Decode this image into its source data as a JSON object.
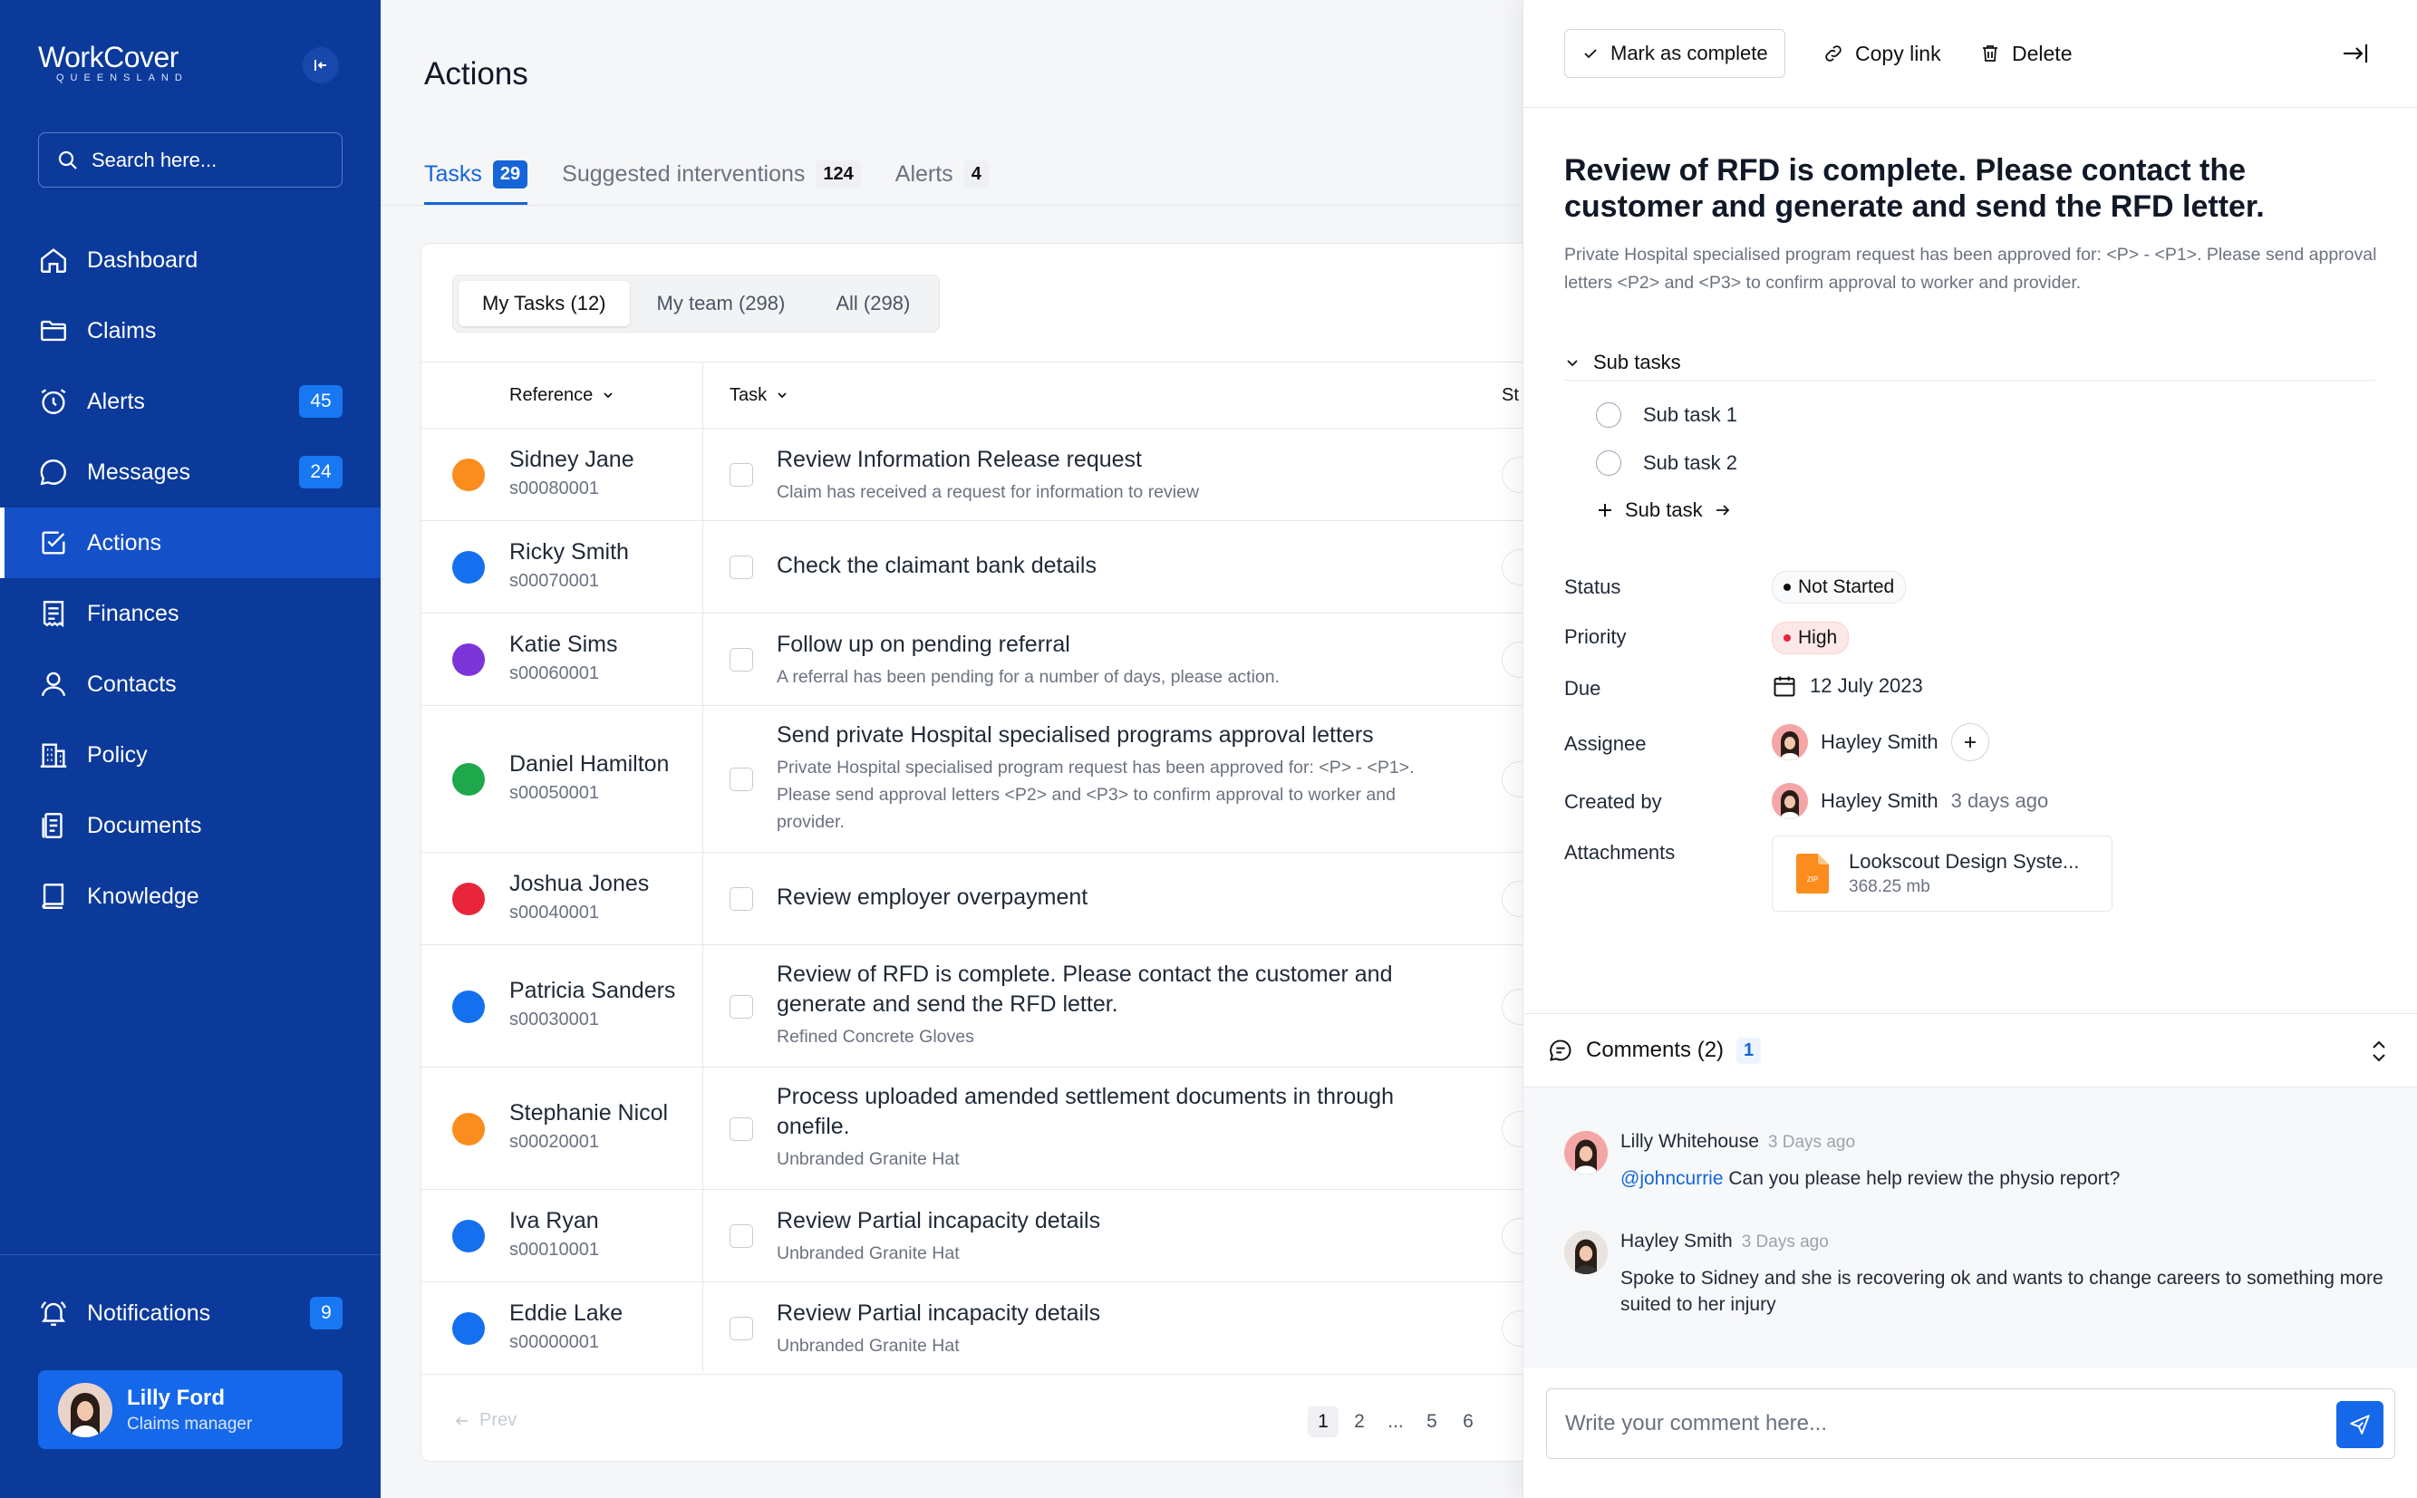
{
  "brand": {
    "logo_main": "WorkCover",
    "logo_sub": "QUEENSLAND"
  },
  "sidebar": {
    "search_placeholder": "Search here...",
    "items": [
      {
        "label": "Dashboard",
        "icon": "home-icon"
      },
      {
        "label": "Claims",
        "icon": "folder-icon"
      },
      {
        "label": "Alerts",
        "icon": "alarm-icon",
        "badge": "45"
      },
      {
        "label": "Messages",
        "icon": "chat-icon",
        "badge": "24"
      },
      {
        "label": "Actions",
        "icon": "checkbox-icon",
        "active": true
      },
      {
        "label": "Finances",
        "icon": "receipt-icon"
      },
      {
        "label": "Contacts",
        "icon": "user-icon"
      },
      {
        "label": "Policy",
        "icon": "building-icon"
      },
      {
        "label": "Documents",
        "icon": "document-icon"
      },
      {
        "label": "Knowledge",
        "icon": "book-icon"
      }
    ],
    "notifications": {
      "label": "Notifications",
      "badge": "9"
    },
    "user": {
      "name": "Lilly Ford",
      "role": "Claims manager"
    }
  },
  "main": {
    "title": "Actions",
    "tabs": [
      {
        "label": "Tasks",
        "count": "29",
        "active": true
      },
      {
        "label": "Suggested interventions",
        "count": "124"
      },
      {
        "label": "Alerts",
        "count": "4"
      }
    ],
    "segments": [
      "My Tasks (12)",
      "My team (298)",
      "All (298)"
    ],
    "columns": {
      "reference": "Reference",
      "task": "Task",
      "status": "St"
    },
    "rows": [
      {
        "name": "Sidney Jane",
        "id": "s00080001",
        "color": "#fb8c1e",
        "title": "Review Information Release request",
        "sub": "Claim has received a request for information to review"
      },
      {
        "name": "Ricky Smith",
        "id": "s00070001",
        "color": "#1570ef",
        "title": "Check the claimant bank details",
        "sub": ""
      },
      {
        "name": "Katie Sims",
        "id": "s00060001",
        "color": "#7c35d8",
        "title": "Follow up on pending referral",
        "sub": "A referral has been pending for a number of days, please action."
      },
      {
        "name": "Daniel Hamilton",
        "id": "s00050001",
        "color": "#1ea84b",
        "title": "Send private Hospital specialised programs approval letters",
        "sub": "Private Hospital specialised program request has been approved for: <P> - <P1>. Please send approval letters <P2> and <P3> to confirm approval to worker and provider."
      },
      {
        "name": "Joshua Jones",
        "id": "s00040001",
        "color": "#e8253b",
        "title": "Review employer overpayment",
        "sub": ""
      },
      {
        "name": "Patricia Sanders",
        "id": "s00030001",
        "color": "#1570ef",
        "title": "Review of RFD is complete. Please contact the customer and generate and send the RFD letter.",
        "sub": "Refined Concrete Gloves"
      },
      {
        "name": "Stephanie Nicol",
        "id": "s00020001",
        "color": "#fb8c1e",
        "title": "Process uploaded amended settlement documents in through onefile.",
        "sub": "Unbranded Granite Hat"
      },
      {
        "name": "Iva Ryan",
        "id": "s00010001",
        "color": "#1570ef",
        "title": "Review Partial incapacity details",
        "sub": "Unbranded Granite Hat"
      },
      {
        "name": "Eddie Lake",
        "id": "s00000001",
        "color": "#1570ef",
        "title": "Review Partial incapacity details",
        "sub": "Unbranded Granite Hat"
      }
    ],
    "pager": {
      "prev": "Prev",
      "pages": [
        "1",
        "2",
        "...",
        "5",
        "6"
      ]
    }
  },
  "panel": {
    "mark_complete": "Mark as complete",
    "copy_link": "Copy link",
    "delete": "Delete",
    "title": "Review of RFD is complete. Please contact the customer and generate and send the RFD letter.",
    "description": "Private Hospital specialised program request has been approved for: <P> - <P1>. Please send approval letters <P2> and <P3> to confirm approval to worker and provider.",
    "subtasks_label": "Sub tasks",
    "subtasks": [
      "Sub task 1",
      "Sub task 2"
    ],
    "add_subtask": "Sub task",
    "fields": {
      "status_label": "Status",
      "status": "Not Started",
      "priority_label": "Priority",
      "priority": "High",
      "due_label": "Due",
      "due": "12 July 2023",
      "assignee_label": "Assignee",
      "assignee": "Hayley Smith",
      "created_label": "Created by",
      "created_by": "Hayley Smith",
      "created_when": "3 days ago",
      "attachments_label": "Attachments"
    },
    "attachment": {
      "name": "Lookscout Design Syste...",
      "size": "368.25 mb",
      "ext": "ZIP"
    },
    "comments": {
      "title": "Comments (2)",
      "badge": "1",
      "items": [
        {
          "author": "Lilly Whitehouse",
          "time": "3 Days ago",
          "mention": "@johncurrie",
          "text": " Can you please help review the physio report?"
        },
        {
          "author": "Hayley Smith",
          "time": "3 Days ago",
          "mention": "",
          "text": "Spoke to Sidney and she is recovering ok and wants to change careers to something more suited to her injury"
        }
      ],
      "placeholder": "Write your comment here..."
    }
  }
}
